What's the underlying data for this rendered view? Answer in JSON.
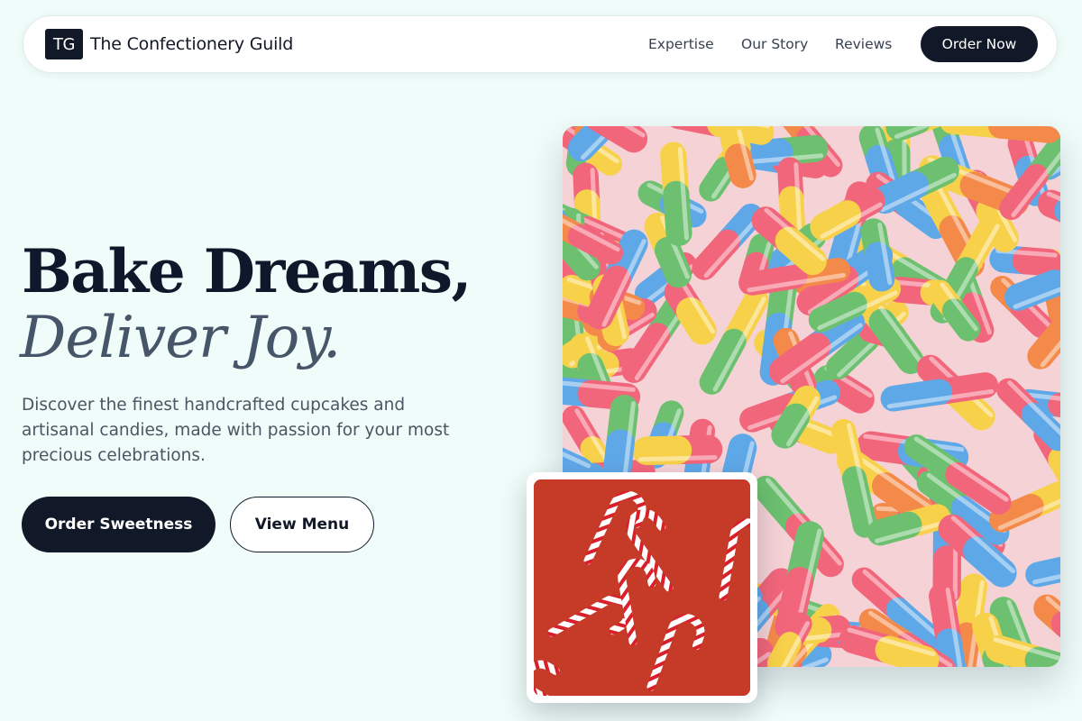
{
  "nav": {
    "logo_initials": "TG",
    "brand": "The Confectionery Guild",
    "links": [
      "Expertise",
      "Our Story",
      "Reviews"
    ],
    "cta": "Order Now"
  },
  "hero": {
    "headline_line1": "Bake Dreams,",
    "headline_line2": "Deliver Joy.",
    "subtitle": "Discover the finest handcrafted cupcakes and artisanal candies, made with passion for your most precious celebrations.",
    "primary_button": "Order Sweetness",
    "secondary_button": "View Menu"
  },
  "images": {
    "main": "sour-gummy-worms-photo",
    "inset": "candy-canes-photo"
  },
  "colors": {
    "background": "#effcf9",
    "primary": "#111827",
    "accent_text": "#475569",
    "muted_text": "#4b5563"
  }
}
